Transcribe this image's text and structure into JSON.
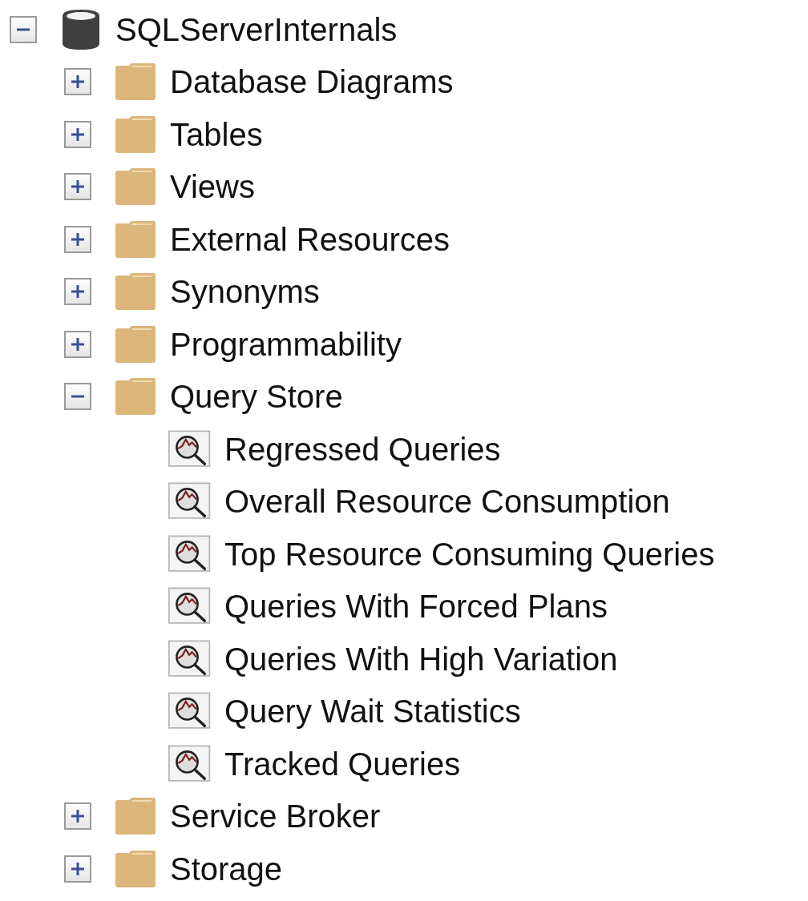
{
  "tree": {
    "label": "SQLServerInternals",
    "kind": "database",
    "expanded": true,
    "children": [
      {
        "label": "Database Diagrams",
        "kind": "folder",
        "expanded": false
      },
      {
        "label": "Tables",
        "kind": "folder",
        "expanded": false
      },
      {
        "label": "Views",
        "kind": "folder",
        "expanded": false
      },
      {
        "label": "External Resources",
        "kind": "folder",
        "expanded": false
      },
      {
        "label": "Synonyms",
        "kind": "folder",
        "expanded": false
      },
      {
        "label": "Programmability",
        "kind": "folder",
        "expanded": false
      },
      {
        "label": "Query Store",
        "kind": "folder",
        "expanded": true,
        "children": [
          {
            "label": "Regressed Queries",
            "kind": "report"
          },
          {
            "label": "Overall Resource Consumption",
            "kind": "report"
          },
          {
            "label": "Top Resource Consuming Queries",
            "kind": "report"
          },
          {
            "label": "Queries With Forced Plans",
            "kind": "report"
          },
          {
            "label": "Queries With High Variation",
            "kind": "report"
          },
          {
            "label": "Query Wait Statistics",
            "kind": "report"
          },
          {
            "label": "Tracked Queries",
            "kind": "report"
          }
        ]
      },
      {
        "label": "Service Broker",
        "kind": "folder",
        "expanded": false
      },
      {
        "label": "Storage",
        "kind": "folder",
        "expanded": false
      }
    ]
  }
}
